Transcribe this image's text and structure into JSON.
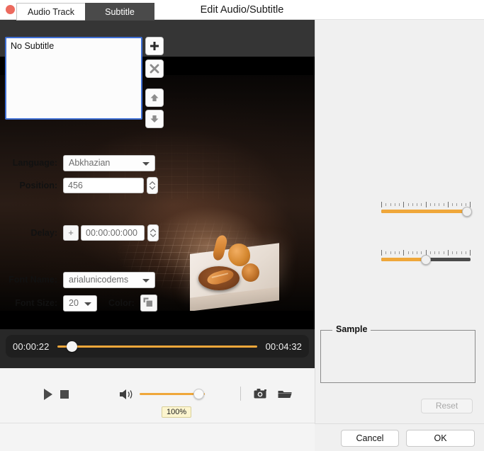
{
  "window": {
    "title": "Edit Audio/Subtitle",
    "close_icon": "close-dot-icon"
  },
  "tabs": [
    {
      "label": "Audio Track",
      "active": false
    },
    {
      "label": "Subtitle",
      "active": true
    }
  ],
  "subtitle_list": {
    "items": [
      "No Subtitle"
    ],
    "selected_index": 0
  },
  "list_side_buttons": [
    {
      "name": "add-subtitle-button",
      "icon": "plus-icon"
    },
    {
      "name": "remove-subtitle-button",
      "icon": "x-icon"
    },
    {
      "name": "move-up-button",
      "icon": "arrow-up-icon"
    },
    {
      "name": "move-down-button",
      "icon": "arrow-down-icon"
    }
  ],
  "fields": {
    "language": {
      "label": "Language:",
      "value": "Abkhazian"
    },
    "position": {
      "label": "Position:",
      "value": "456",
      "slider_percent": 96
    },
    "delay": {
      "label": "Delay:",
      "plus_label": "+",
      "value": "00:00:00:000",
      "slider_percent": 50
    },
    "font_name": {
      "label": "Font Name:",
      "value": "arialunicodems"
    },
    "font_size": {
      "label": "Font Size:",
      "value": "20"
    },
    "color": {
      "label": "Color:",
      "icon": "color-swatch-icon"
    }
  },
  "sample": {
    "title": "Sample",
    "content": ""
  },
  "reset_button": {
    "label": "Reset",
    "enabled": false
  },
  "dialog_buttons": {
    "cancel": "Cancel",
    "ok": "OK"
  },
  "player": {
    "current_time": "00:00:22",
    "total_time": "00:04:32",
    "progress_percent": 7,
    "play_icon": "play-icon",
    "stop_icon": "stop-icon",
    "volume_icon": "volume-icon",
    "volume_percent": 100,
    "volume_tooltip": "100%",
    "snapshot_icon": "camera-icon",
    "folder_icon": "folder-icon"
  },
  "colors": {
    "accent_orange": "#efa73a",
    "tab_active_bg": "#4a4a4a",
    "list_focus_border": "#3f6fd4",
    "close_red": "#ec6a5e"
  }
}
